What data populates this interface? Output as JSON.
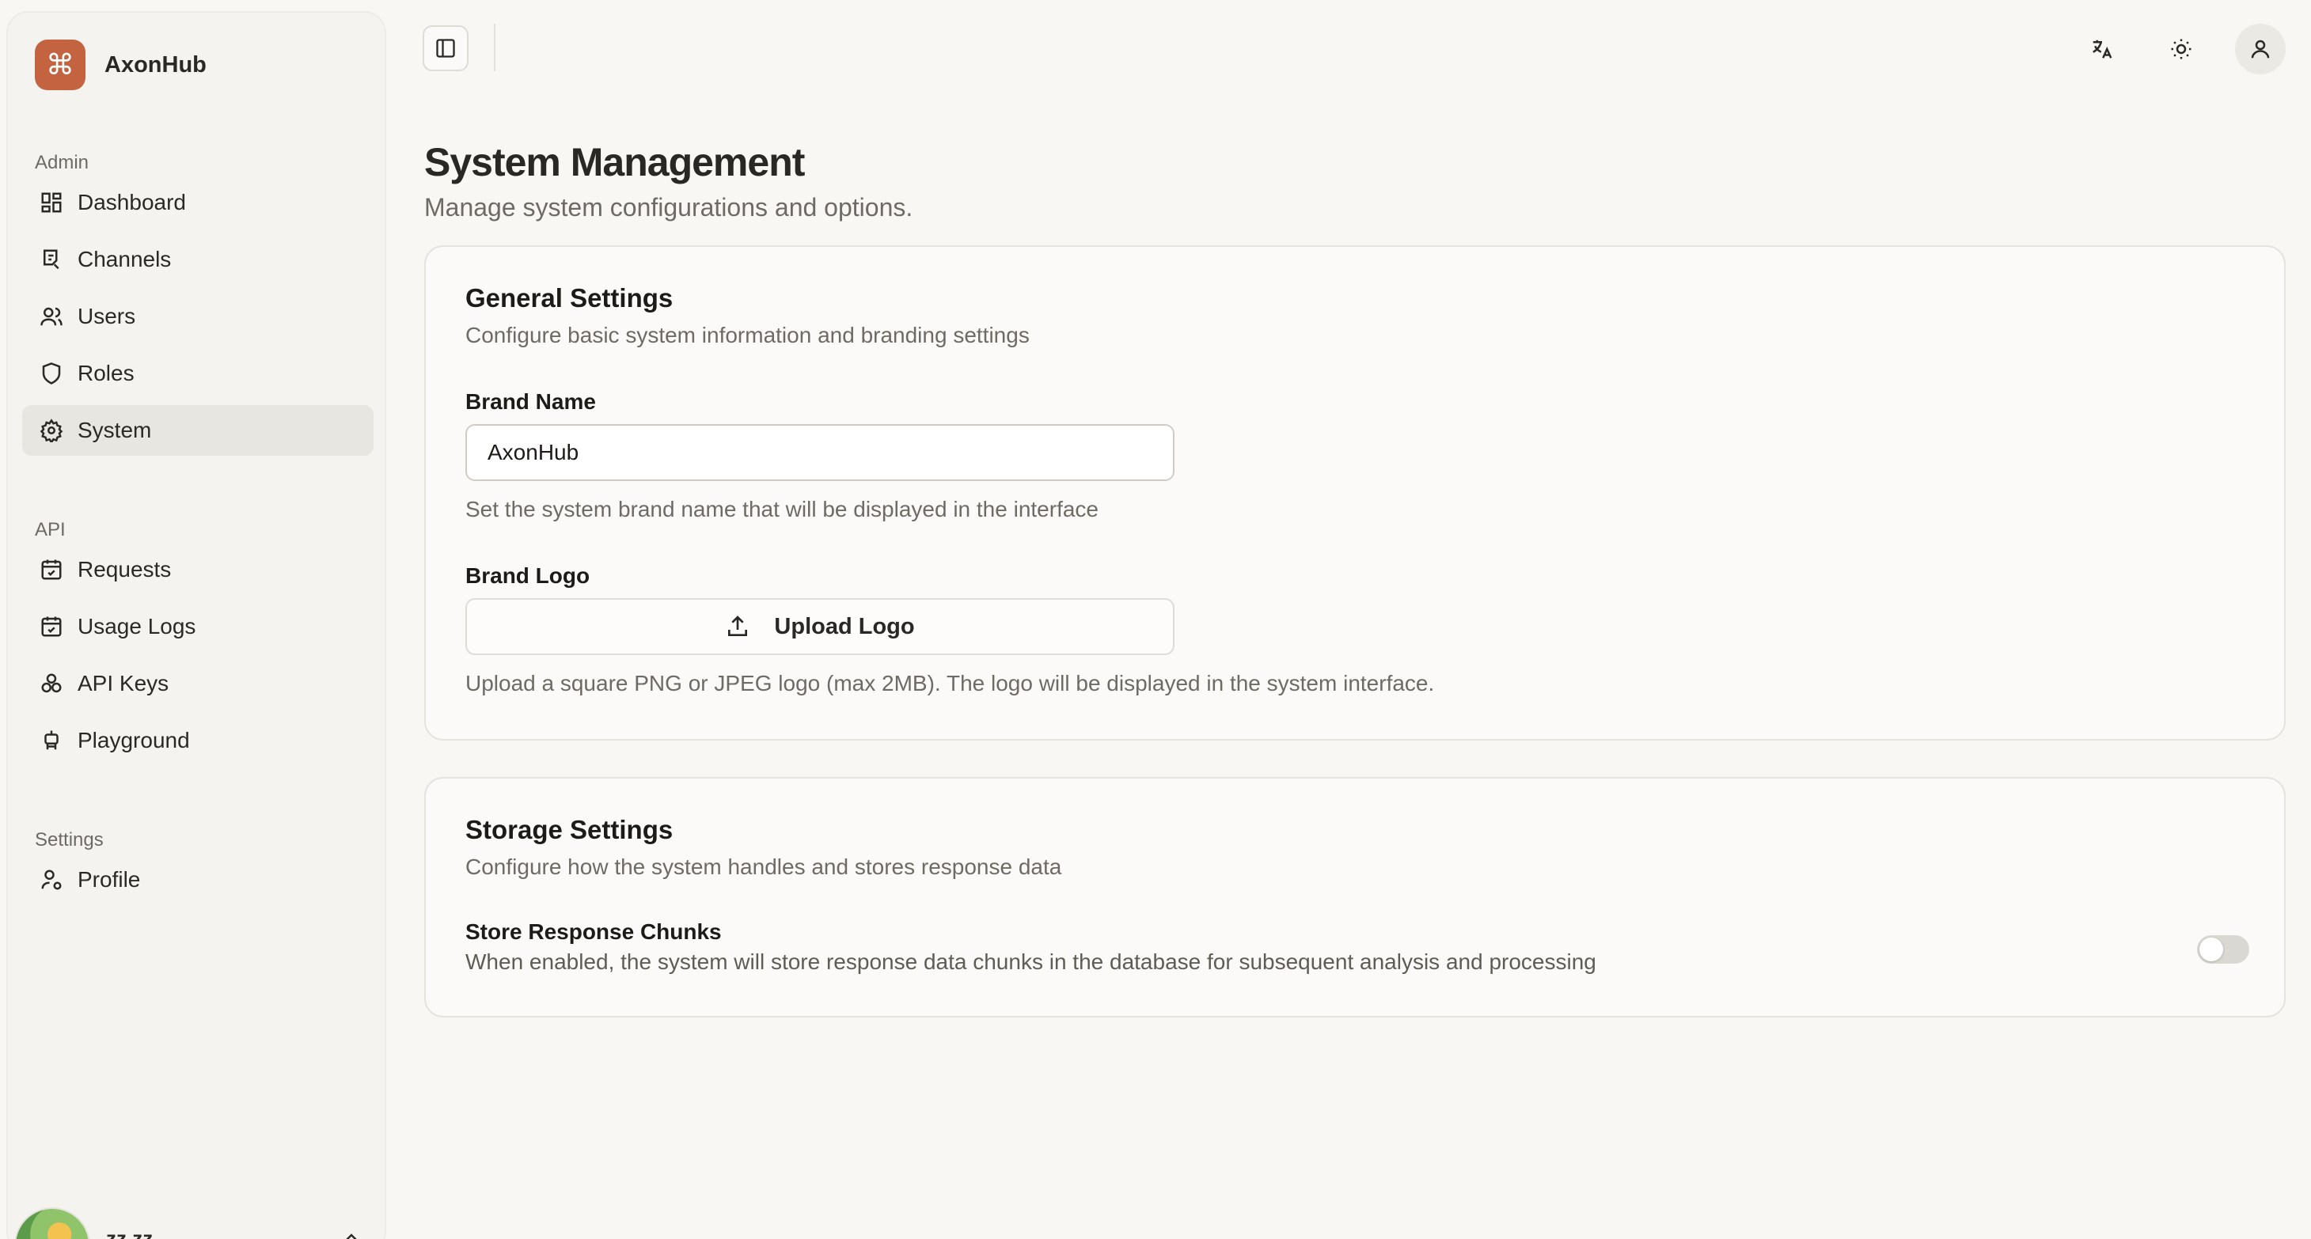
{
  "sidebar": {
    "brand": {
      "icon": "command-icon",
      "name": "AxonHub"
    },
    "groups": [
      {
        "label": "Admin",
        "items": [
          {
            "label": "Dashboard",
            "icon": "dashboard-icon"
          },
          {
            "label": "Channels",
            "icon": "channels-icon"
          },
          {
            "label": "Users",
            "icon": "users-icon"
          },
          {
            "label": "Roles",
            "icon": "shield-icon"
          },
          {
            "label": "System",
            "icon": "gear-icon",
            "active": true
          }
        ]
      },
      {
        "label": "API",
        "items": [
          {
            "label": "Requests",
            "icon": "calendar-check-icon"
          },
          {
            "label": "Usage Logs",
            "icon": "calendar-check-icon"
          },
          {
            "label": "API Keys",
            "icon": "keys-icon"
          },
          {
            "label": "Playground",
            "icon": "robot-icon"
          }
        ]
      },
      {
        "label": "Settings",
        "items": [
          {
            "label": "Profile",
            "icon": "user-cog-icon"
          }
        ]
      }
    ],
    "user": {
      "name": "zz zz"
    }
  },
  "topbar": {
    "icons": [
      "sidebar-toggle-icon",
      "translate-icon",
      "sun-icon",
      "user-icon"
    ]
  },
  "page": {
    "title": "System Management",
    "subtitle": "Manage system configurations and options."
  },
  "general": {
    "title": "General Settings",
    "description": "Configure basic system information and branding settings",
    "brand_name_label": "Brand Name",
    "brand_name_value": "AxonHub",
    "brand_name_help": "Set the system brand name that will be displayed in the interface",
    "brand_logo_label": "Brand Logo",
    "upload_label": "Upload Logo",
    "brand_logo_help": "Upload a square PNG or JPEG logo (max 2MB). The logo will be displayed in the system interface."
  },
  "storage": {
    "title": "Storage Settings",
    "description": "Configure how the system handles and stores response data",
    "chunks_label": "Store Response Chunks",
    "chunks_help": "When enabled, the system will store response data chunks in the database for subsequent analysis and processing",
    "chunks_enabled": false
  },
  "colors": {
    "accent": "#c3633f",
    "background": "#f8f7f4",
    "active_item": "#e8e6e0"
  }
}
